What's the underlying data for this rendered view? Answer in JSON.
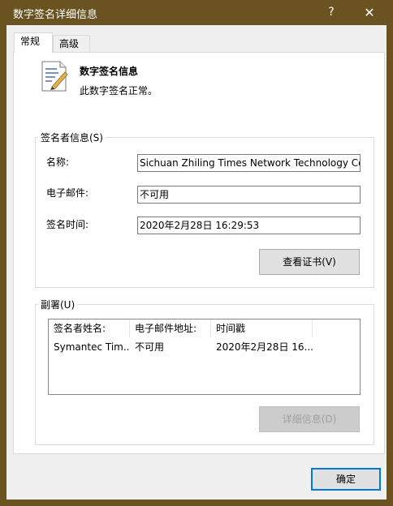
{
  "window": {
    "title": "数字签名详细信息",
    "help_glyph": "?",
    "close_glyph": "✕"
  },
  "tabs": [
    {
      "label": "常规",
      "active": true
    },
    {
      "label": "高级",
      "active": false
    }
  ],
  "header": {
    "title": "数字签名信息",
    "status": "此数字签名正常。"
  },
  "signer": {
    "group_label": "签名者信息(S)",
    "name_label": "名称:",
    "name_value": "Sichuan Zhiling Times Network Technology Co",
    "email_label": "电子邮件:",
    "email_value": "不可用",
    "time_label": "签名时间:",
    "time_value": "2020年2月28日 16:29:53",
    "view_cert_button": "查看证书(V)"
  },
  "countersign": {
    "group_label": "副署(U)",
    "columns": [
      "签名者姓名:",
      "电子邮件地址:",
      "时间戳"
    ],
    "rows": [
      [
        "Symantec Tim...",
        "不可用",
        "2020年2月28日 16..."
      ]
    ],
    "details_button": "详细信息(D)"
  },
  "footer": {
    "ok_button": "确定"
  },
  "colors": {
    "title_bar": "#6a5320",
    "dialog_bg": "#f0f0f0",
    "accent": "#0078d7"
  }
}
